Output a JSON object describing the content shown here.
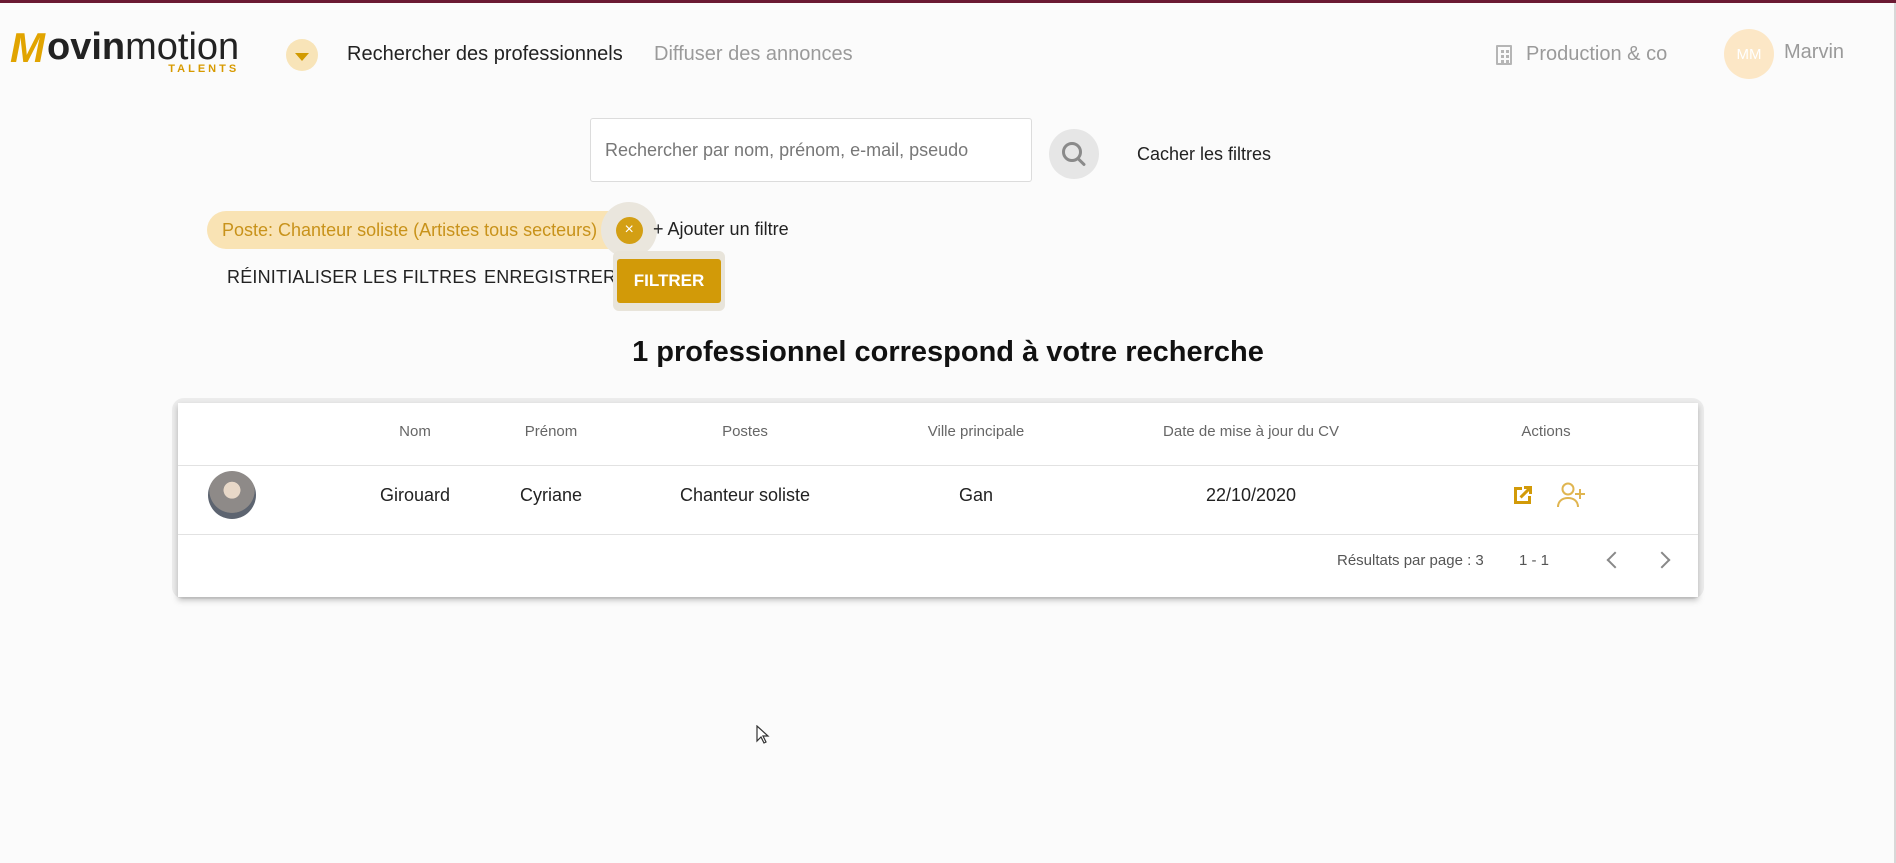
{
  "header": {
    "logo": {
      "mark": "M",
      "word_bold": "ovin",
      "word_light": "motion",
      "sub": "TALENTS"
    },
    "nav": {
      "search_professionals": "Rechercher des professionnels",
      "post_ads": "Diffuser des annonces"
    },
    "company": "Production & co",
    "user": {
      "initials": "MM",
      "name": "Marvin"
    }
  },
  "search": {
    "placeholder": "Rechercher par nom, prénom, e-mail, pseudo",
    "value": "",
    "hide_filters": "Cacher les filtres"
  },
  "filters": {
    "active_chip": "Poste: Chanteur soliste (Artistes tous secteurs)",
    "chip_close": "×",
    "add_filter": "+ Ajouter un filtre",
    "reset": "RÉINITIALISER LES FILTRES",
    "save": "ENREGISTRER",
    "apply": "FILTRER"
  },
  "results": {
    "title": "1 professionnel correspond à votre recherche",
    "columns": [
      "Nom",
      "Prénom",
      "Postes",
      "Ville principale",
      "Date de mise à jour du CV",
      "Actions"
    ],
    "rows": [
      {
        "nom": "Girouard",
        "prenom": "Cyriane",
        "poste": "Chanteur soliste",
        "ville": "Gan",
        "date_cv": "22/10/2020"
      }
    ],
    "pagination": {
      "per_page_label": "Résultats par page : 3",
      "range": "1 - 1"
    }
  },
  "colors": {
    "accent": "#d29a08",
    "chip_bg": "#f9e3b4",
    "top_border": "#6b1a33"
  }
}
